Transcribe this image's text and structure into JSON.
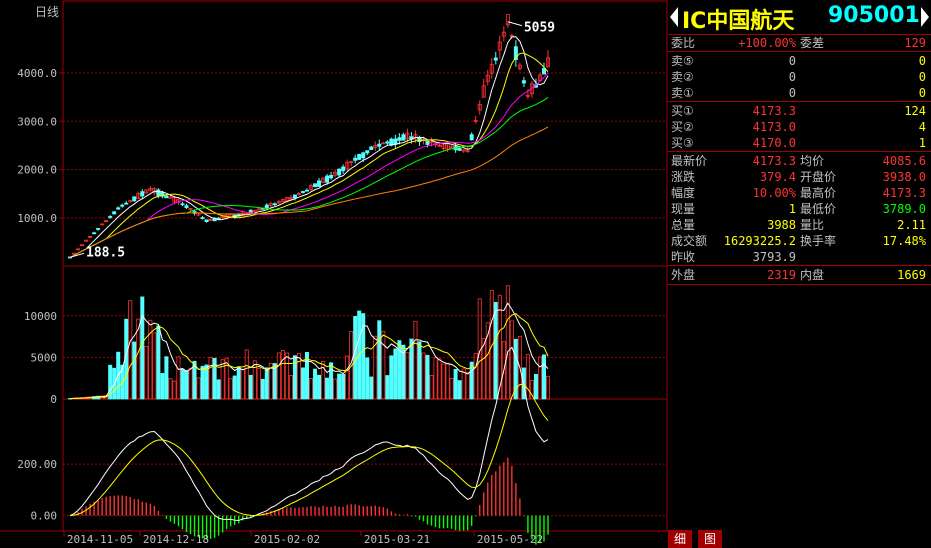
{
  "chart_data": {
    "type": "candlestick",
    "period_label": "日线",
    "dates": [
      "2014-11-05",
      "2014-12-18",
      "2015-02-02",
      "2015-03-21",
      "2015-05-22"
    ],
    "price_axis": {
      "ticks": [
        "4000.0",
        "3000.0",
        "2000.0",
        "1000.0"
      ],
      "values": [
        4000,
        3000,
        2000,
        1000
      ],
      "range": [
        50,
        5300
      ]
    },
    "high_label": "5059",
    "low_label": "188.5",
    "high": 5059,
    "low": 188.5,
    "volume_axis": {
      "ticks": [
        "10000",
        "5000",
        "0"
      ],
      "values": [
        10000,
        5000,
        0
      ],
      "range": [
        0,
        15500
      ]
    },
    "macd_axis": {
      "ticks": [
        "200.00",
        "0.00"
      ],
      "values": [
        200,
        0
      ],
      "range": [
        -60,
        430
      ]
    },
    "up_color": "#ff3232",
    "down_color": "#54ffff",
    "ma_colors": [
      "#ffffff",
      "#ffff00",
      "#ff00ff",
      "#00ff00",
      "#ff8000"
    ]
  },
  "quote": {
    "name": "IC中国航天",
    "code": "905001",
    "weibi_label": "委比",
    "weibi": "+100.00%",
    "weicha_label": "委差",
    "weicha": "129",
    "sell": [
      {
        "label": "卖⑤",
        "price": "0",
        "vol": "0"
      },
      {
        "label": "卖②",
        "price": "0",
        "vol": "0"
      },
      {
        "label": "卖①",
        "price": "0",
        "vol": "0"
      }
    ],
    "buy": [
      {
        "label": "买①",
        "price": "4173.3",
        "vol": "124"
      },
      {
        "label": "买②",
        "price": "4173.0",
        "vol": "4"
      },
      {
        "label": "买③",
        "price": "4170.0",
        "vol": "1"
      }
    ],
    "stats": [
      {
        "l1": "最新价",
        "v1": "4173.3",
        "c1": "#ff3232",
        "l2": "均价",
        "v2": "4085.6",
        "c2": "#ff3232"
      },
      {
        "l1": "涨跌",
        "v1": "379.4",
        "c1": "#ff3232",
        "l2": "开盘价",
        "v2": "3938.0",
        "c2": "#ff3232"
      },
      {
        "l1": "幅度",
        "v1": "10.00%",
        "c1": "#ff3232",
        "l2": "最高价",
        "v2": "4173.3",
        "c2": "#ff3232"
      },
      {
        "l1": "现量",
        "v1": "1",
        "c1": "#ffff00",
        "l2": "最低价",
        "v2": "3789.0",
        "c2": "#00ff00"
      },
      {
        "l1": "总量",
        "v1": "3988",
        "c1": "#ffff00",
        "l2": "量比",
        "v2": "2.11",
        "c2": "#ffff00"
      },
      {
        "l1": "成交额",
        "v1": "16293225.2",
        "c1": "#ffff00",
        "l2": "换手率",
        "v2": "17.48%",
        "c2": "#ffff00"
      },
      {
        "l1": "昨收",
        "v1": "3793.9",
        "c1": "#c0c0c0",
        "l2": "",
        "v2": "",
        "c2": "#c0c0c0"
      }
    ],
    "outer_label": "外盘",
    "outer": "2319",
    "inner_label": "内盘",
    "inner": "1669"
  },
  "tabs": [
    "细",
    "图"
  ]
}
